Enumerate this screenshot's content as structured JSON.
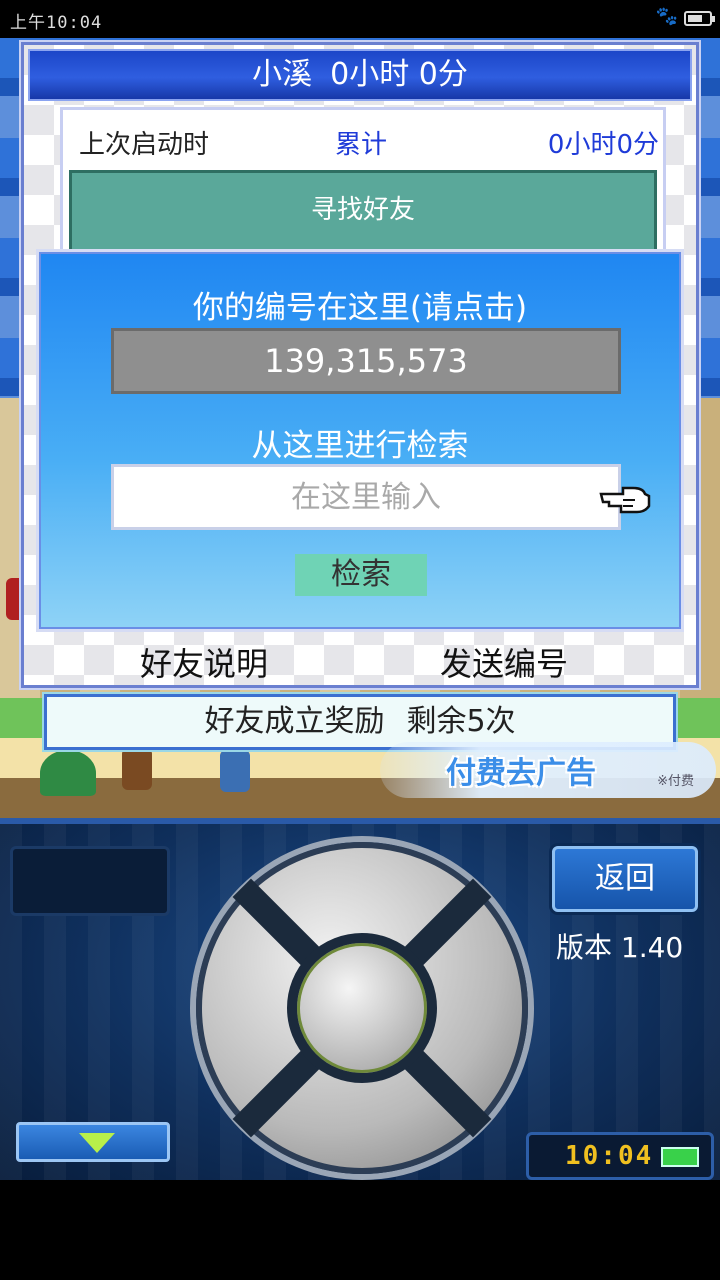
{
  "status_bar": {
    "time": "上午10:04"
  },
  "dialog": {
    "title_name": "小溪",
    "title_time": "0小时 0分",
    "last_launch_label": "上次启动时",
    "total_label": "累计",
    "total_value": "0小时0分",
    "find_friend_button": "寻找好友",
    "friend_help_link": "好友说明",
    "send_id_link": "发送编号"
  },
  "id_panel": {
    "your_id_heading": "你的编号在这里(请点击)",
    "your_id_value": "139,315,573",
    "search_heading": "从这里进行检索",
    "search_placeholder": "在这里输入",
    "search_button": "检索"
  },
  "reward_banner": {
    "label": "好友成立奖励",
    "remaining": "剩余5次"
  },
  "ad_banner": {
    "label": "付费去广告",
    "note": "※付费"
  },
  "controls": {
    "back_button": "返回",
    "version": "版本 1.40",
    "clock": "10:04"
  },
  "icons": {
    "status_battery_level": 0.7,
    "console_battery_level": 0.9,
    "pointer": "pointing-hand-icon",
    "down": "down-arrow-icon",
    "paw": "paw-icon"
  }
}
